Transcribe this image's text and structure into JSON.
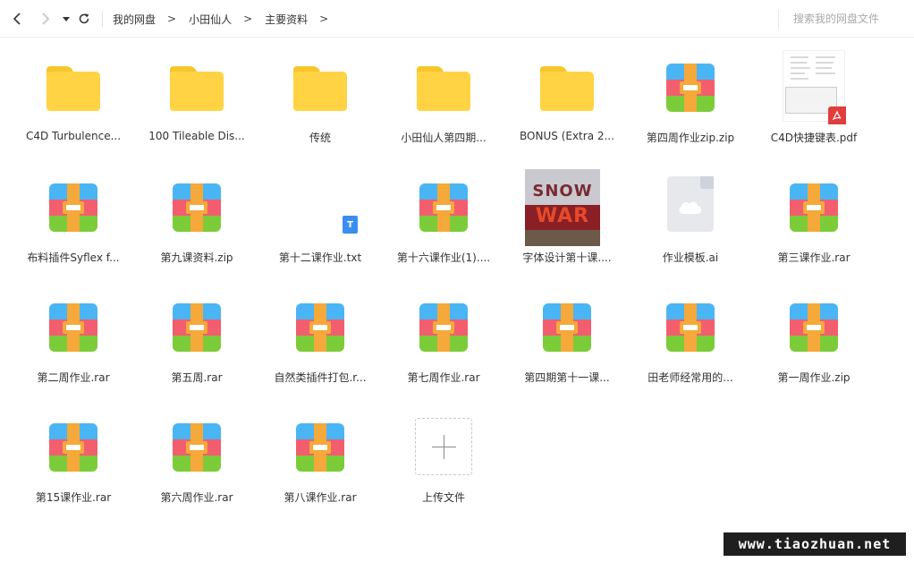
{
  "breadcrumb": {
    "items": [
      "我的网盘",
      "小田仙人",
      "主要资料"
    ],
    "separator": ">"
  },
  "search": {
    "placeholder": "搜索我的网盘文件"
  },
  "icons": {
    "back": "chevron-left-icon",
    "forward": "chevron-right-icon",
    "history": "caret-down-icon",
    "refresh": "refresh-icon"
  },
  "files": [
    {
      "name": "C4D Turbulence...",
      "type": "folder"
    },
    {
      "name": "100 Tileable Dis...",
      "type": "folder"
    },
    {
      "name": "传统",
      "type": "folder"
    },
    {
      "name": "小田仙人第四期...",
      "type": "folder"
    },
    {
      "name": "BONUS (Extra 2...",
      "type": "folder"
    },
    {
      "name": "第四周作业zip.zip",
      "type": "archive"
    },
    {
      "name": "C4D快捷键表.pdf",
      "type": "pdf"
    },
    {
      "name": "布料插件Syflex f...",
      "type": "archive"
    },
    {
      "name": "第九课资料.zip",
      "type": "archive"
    },
    {
      "name": "第十二课作业.txt",
      "type": "txt"
    },
    {
      "name": "第十六课作业(1)....",
      "type": "archive"
    },
    {
      "name": "字体设计第十课....",
      "type": "image"
    },
    {
      "name": "作业模板.ai",
      "type": "ai"
    },
    {
      "name": "第三课作业.rar",
      "type": "archive"
    },
    {
      "name": "第二周作业.rar",
      "type": "archive"
    },
    {
      "name": "第五周.rar",
      "type": "archive"
    },
    {
      "name": "自然类插件打包.r...",
      "type": "archive"
    },
    {
      "name": "第七周作业.rar",
      "type": "archive"
    },
    {
      "name": "第四期第十一课...",
      "type": "archive"
    },
    {
      "name": "田老师经常用的...",
      "type": "archive"
    },
    {
      "name": "第一周作业.zip",
      "type": "archive"
    },
    {
      "name": "第15课作业.rar",
      "type": "archive"
    },
    {
      "name": "第六周作业.rar",
      "type": "archive"
    },
    {
      "name": "第八课作业.rar",
      "type": "archive"
    }
  ],
  "upload": {
    "label": "上传文件"
  },
  "thumbnail_text": {
    "line1": "SNOW",
    "line2": "WAR"
  },
  "txt_badge": "T",
  "watermark": "www.tiaozhuan.net",
  "colors": {
    "folder": "#ffd343",
    "archive_top": "#4ab5f4",
    "archive_mid": "#f25e6e",
    "archive_bottom": "#7ccc3a",
    "archive_strap": "#f4a93a",
    "txt_badge": "#3b8ef0",
    "pdf_badge": "#e03d3d"
  }
}
